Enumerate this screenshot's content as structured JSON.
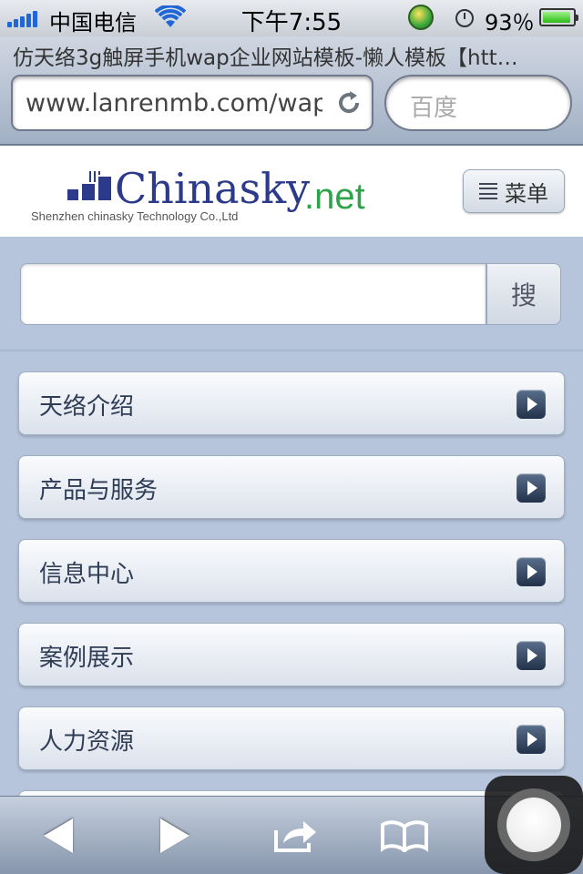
{
  "status_bar": {
    "carrier": "中国电信",
    "time": "下午7:55",
    "battery": "93％",
    "battery_level": 0.93
  },
  "browser": {
    "page_title": "仿天络3g触屏手机wap企业网站模板-懒人模板【htt…",
    "url": "www.lanrenmb.com/wap",
    "search_placeholder": "百度"
  },
  "header": {
    "logo": {
      "name": "Chinasky",
      "tld": ".net",
      "tagline": "Shenzhen chinasky Technology Co.,Ltd"
    },
    "menu_label": "菜单"
  },
  "search": {
    "button_label": "搜"
  },
  "nav": {
    "items": [
      {
        "label": "天络介绍"
      },
      {
        "label": "产品与服务"
      },
      {
        "label": "信息中心"
      },
      {
        "label": "案例展示"
      },
      {
        "label": "人力资源"
      },
      {
        "label": ""
      }
    ]
  },
  "colors": {
    "background": "#b6c5db",
    "logo_blue": "#2b3a8a",
    "logo_green": "#2da34a"
  }
}
